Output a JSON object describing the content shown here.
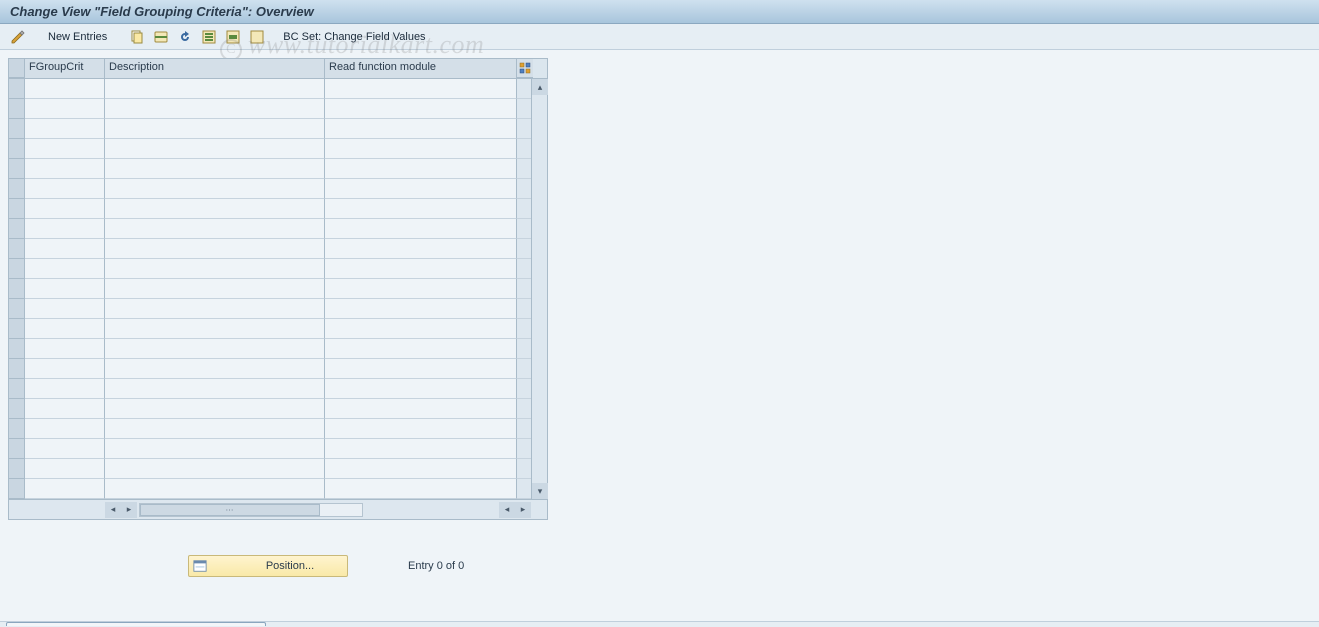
{
  "title": "Change View \"Field Grouping Criteria\": Overview",
  "toolbar": {
    "new_entries_label": "New Entries",
    "bc_set_label": "BC Set: Change Field Values"
  },
  "grid": {
    "columns": {
      "fgroupcrit": "FGroupCrit",
      "description": "Description",
      "read_module": "Read function module"
    },
    "row_count": 21,
    "rows": []
  },
  "footer": {
    "position_label": "Position...",
    "entry_label": "Entry 0 of 0"
  },
  "watermark": "www.tutorialkart.com"
}
